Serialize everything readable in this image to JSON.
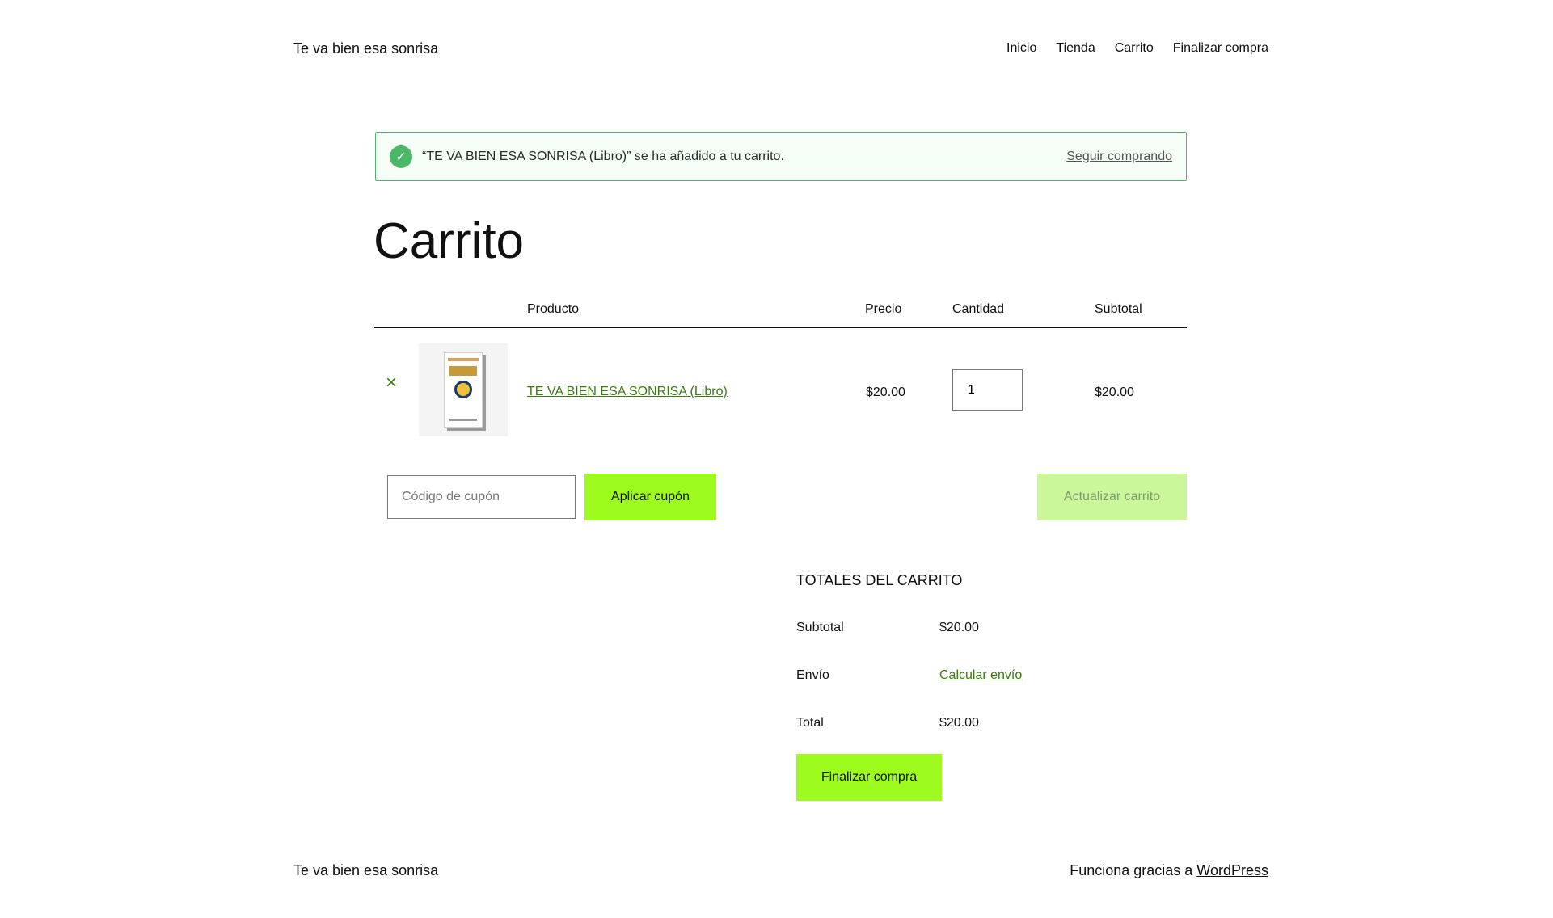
{
  "header": {
    "site_title": "Te va bien esa sonrisa",
    "nav": [
      "Inicio",
      "Tienda",
      "Carrito",
      "Finalizar compra"
    ]
  },
  "notice": {
    "message": "“TE VA BIEN ESA SONRISA (Libro)” se ha añadido a tu carrito.",
    "link": "Seguir comprando"
  },
  "page_title": "Carrito",
  "table": {
    "headers": {
      "product": "Producto",
      "price": "Precio",
      "quantity": "Cantidad",
      "subtotal": "Subtotal"
    },
    "rows": [
      {
        "remove": "×",
        "name": "TE VA BIEN ESA SONRISA (Libro)",
        "price": "$20.00",
        "quantity": "1",
        "subtotal": "$20.00"
      }
    ]
  },
  "coupon": {
    "placeholder": "Código de cupón",
    "apply_label": "Aplicar cupón"
  },
  "update_label": "Actualizar carrito",
  "totals": {
    "title": "TOTALES DEL CARRITO",
    "subtotal_label": "Subtotal",
    "subtotal_value": "$20.00",
    "shipping_label": "Envío",
    "shipping_link": "Calcular envío",
    "total_label": "Total",
    "total_value": "$20.00",
    "checkout_label": "Finalizar compra"
  },
  "footer": {
    "site_title": "Te va bien esa sonrisa",
    "credit_prefix": "Funciona gracias a ",
    "credit_link": "WordPress"
  },
  "colors": {
    "accent": "#9dfc1e",
    "accent_disabled": "#caf79a",
    "link": "#3d7a10",
    "notice_border": "#4ab866",
    "notice_bg": "#f4fdf6"
  },
  "icons": {
    "notice": "check-circle-icon",
    "remove": "close-icon"
  }
}
